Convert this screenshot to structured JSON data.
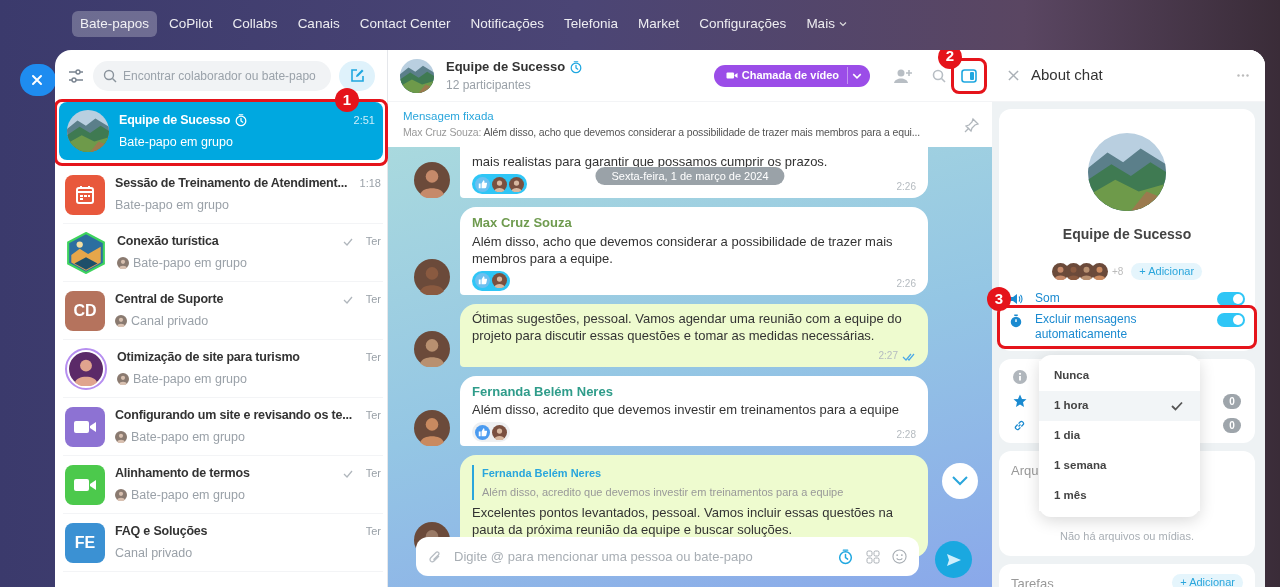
{
  "nav": {
    "items": [
      {
        "label": "Bate-papos",
        "selected": true,
        "kind": "link"
      },
      {
        "label": "CoPilot",
        "selected": false,
        "kind": "link"
      },
      {
        "label": "Collabs",
        "selected": false,
        "kind": "link"
      },
      {
        "label": "Canais",
        "selected": false,
        "kind": "link"
      },
      {
        "label": "Contact Center",
        "selected": false,
        "kind": "link"
      },
      {
        "label": "Notificações",
        "selected": false,
        "kind": "link"
      },
      {
        "label": "Telefonia",
        "selected": false,
        "kind": "link"
      },
      {
        "label": "Market",
        "selected": false,
        "kind": "link"
      },
      {
        "label": "Configurações",
        "selected": false,
        "kind": "link"
      },
      {
        "label": "Mais",
        "selected": false,
        "kind": "menu"
      }
    ]
  },
  "sidebar": {
    "search_placeholder": "Encontrar colaborador ou bate-papo",
    "chats": [
      {
        "title": "Equipe de Sucesso",
        "subtitle": "Bate-papo em grupo",
        "time": "2:51",
        "selected": true,
        "timer": true,
        "read": false,
        "sender": false,
        "annotation": "1"
      },
      {
        "title": "Sessão de Treinamento de Atendiment...",
        "subtitle": "Bate-papo em grupo",
        "time": "1:18",
        "selected": false,
        "timer": false,
        "read": false,
        "sender": false,
        "avatar": {
          "kind": "calendar",
          "color": "#e8583c"
        }
      },
      {
        "title": "Conexão turística",
        "subtitle": "Bate-papo em grupo",
        "time": "Ter",
        "selected": false,
        "timer": false,
        "read": true,
        "sender": true,
        "avatar": {
          "kind": "hexagon"
        }
      },
      {
        "title": "Central de Suporte",
        "subtitle": "Canal privado",
        "time": "Ter",
        "selected": false,
        "timer": false,
        "read": true,
        "sender": true,
        "avatar": {
          "kind": "initials",
          "initials": "CD",
          "color": "#b5735d"
        }
      },
      {
        "title": "Otimização de site para turismo",
        "subtitle": "Bate-papo em grupo",
        "time": "Ter",
        "selected": false,
        "timer": false,
        "read": false,
        "sender": true,
        "avatar": {
          "kind": "person"
        }
      },
      {
        "title": "Configurando um site e revisando os te...",
        "subtitle": "Bate-papo em grupo",
        "time": "Ter",
        "selected": false,
        "timer": false,
        "read": false,
        "sender": true,
        "avatar": {
          "kind": "video",
          "color": "#8d72d3"
        }
      },
      {
        "title": "Alinhamento de termos",
        "subtitle": "Bate-papo em grupo",
        "time": "Ter",
        "selected": false,
        "timer": false,
        "read": true,
        "sender": true,
        "avatar": {
          "kind": "video",
          "color": "#4cc94c"
        }
      },
      {
        "title": "FAQ e Soluções",
        "subtitle": "Canal privado",
        "time": "Ter",
        "selected": false,
        "timer": false,
        "read": false,
        "sender": false,
        "avatar": {
          "kind": "initials",
          "initials": "FE",
          "color": "#3b91d3"
        }
      }
    ]
  },
  "chat": {
    "title": "Equipe de Sucesso",
    "timer": true,
    "subtitle": "12 participantes",
    "call_button": "Chamada de vídeo",
    "panel_annotation": "2",
    "pinned": {
      "label": "Mensagem fixada",
      "author": "Max Cruz Souza:",
      "text": "Além disso, acho que devemos considerar a possibilidade de trazer mais membros para a equi..."
    },
    "date": "Sexta-feira, 1 de março de 2024",
    "messages": [
      {
        "own": false,
        "text": "mais realistas para garantir que possamos cumprir os prazos.",
        "time": "2:26",
        "reactions": {
          "reacted": true,
          "users": [
            {
              "kind": "person"
            },
            {
              "kind": "person"
            }
          ]
        }
      },
      {
        "own": false,
        "author": "Max Cruz Souza",
        "color": "#6f9b4f",
        "text": "Além disso, acho que devemos considerar a possibilidade de trazer mais membros para a equipe.",
        "time": "2:26",
        "reactions": {
          "reacted": true,
          "users": [
            {
              "kind": "person"
            }
          ]
        }
      },
      {
        "own": true,
        "text": "Ótimas sugestões, pessoal. Vamos agendar uma reunião com a equipe do projeto para discutir essas questões e tomar as medidas necessárias.",
        "time": "2:27",
        "read": true
      },
      {
        "own": false,
        "author": "Fernanda Belém Neres",
        "color": "#2f9c8a",
        "text": "Além disso, acredito que devemos investir em treinamentos para a equipe",
        "time": "2:28",
        "reactions": {
          "reacted": false,
          "users": [
            {
              "kind": "person"
            }
          ]
        }
      },
      {
        "own": true,
        "quote": {
          "author": "Fernanda Belém Neres",
          "text": "Além disso, acredito que devemos investir em treinamentos para a equipe"
        },
        "text": "Excelentes pontos levantados, pessoal. Vamos incluir essas questões na pauta da próxima reunião da equipe e buscar soluções."
      }
    ],
    "composer_placeholder": "Digite @ para mencionar uma pessoa ou bate-papo"
  },
  "about": {
    "title": "About chat",
    "name": "Equipe de Sucesso",
    "members_more": "+8",
    "add_member": "+ Adicionar",
    "settings": [
      {
        "kind": "sound",
        "label": "Som",
        "on": true
      },
      {
        "kind": "timer",
        "label": "Excluir mensagens automaticamente",
        "on": true,
        "annotation": "3"
      }
    ],
    "counters": [
      {
        "kind": "info"
      },
      {
        "kind": "star",
        "count": "0"
      },
      {
        "kind": "link",
        "count": "0"
      }
    ],
    "files": {
      "title": "Arqu",
      "empty": "Não há arquivos ou mídias."
    },
    "tasks": {
      "title": "Tarefas",
      "add": "+ Adicionar"
    },
    "dropdown": [
      {
        "label": "Nunca",
        "selected": false
      },
      {
        "label": "1 hora",
        "selected": true
      },
      {
        "label": "1 dia",
        "selected": false
      },
      {
        "label": "1 semana",
        "selected": false
      },
      {
        "label": "1 mês",
        "selected": false
      }
    ]
  }
}
